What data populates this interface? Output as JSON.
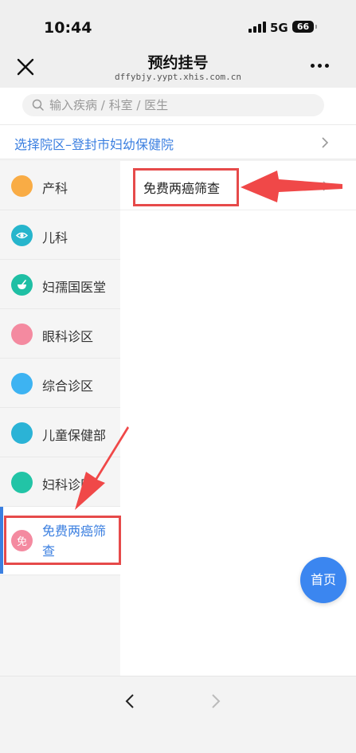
{
  "status_bar": {
    "time": "10:44",
    "network": "5G",
    "battery": "66"
  },
  "nav": {
    "title": "预约挂号",
    "url": "dffybjy.yypt.xhis.com.cn"
  },
  "search": {
    "placeholder": "输入疾病 / 科室 / 医生"
  },
  "area": {
    "label": "选择院区–登封市妇幼保健院"
  },
  "sidebar": {
    "items": [
      {
        "label": "产科",
        "icon": "orange-circle-icon",
        "color": "#f9ac45"
      },
      {
        "label": "儿科",
        "icon": "eye-icon",
        "color": "#26b5cc"
      },
      {
        "label": "妇孺国医堂",
        "icon": "mortar-icon",
        "color": "#1fbfa4"
      },
      {
        "label": "眼科诊区",
        "icon": "pink-circle-icon",
        "color": "#f48aa0"
      },
      {
        "label": "综合诊区",
        "icon": "blue-circle-icon",
        "color": "#3db3f2"
      },
      {
        "label": "儿童保健部",
        "icon": "teal-circle-icon",
        "color": "#2bb3d6"
      },
      {
        "label": "妇科诊区",
        "icon": "green-circle-icon",
        "color": "#22c4a6"
      },
      {
        "label": "免费两癌筛查",
        "icon": "mian-badge-icon",
        "badge": "免",
        "color": "#f48aa0"
      }
    ]
  },
  "content": {
    "items": [
      {
        "label": "免费两癌筛查"
      }
    ]
  },
  "home_button": {
    "label": "首页"
  },
  "colors": {
    "accent": "#3b7fe0",
    "annotation": "#e64a4a"
  }
}
